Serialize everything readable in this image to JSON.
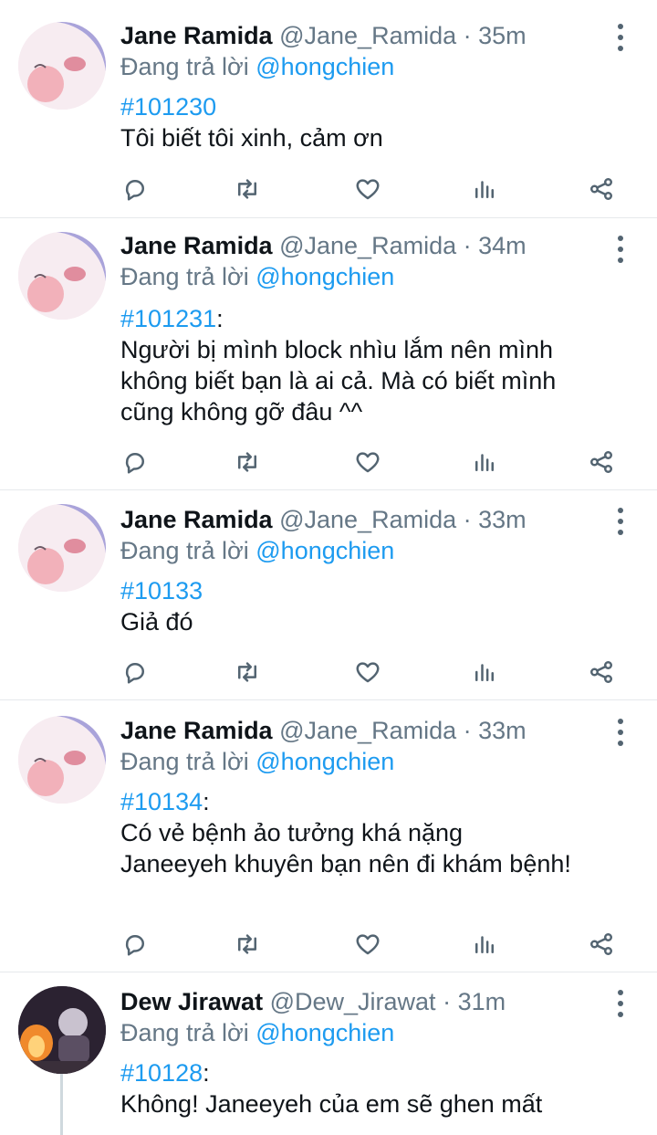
{
  "tweets": [
    {
      "name": "Jane Ramida",
      "handle": "@Jane_Ramida",
      "sep": "·",
      "time": "35m",
      "reply_prefix": "Đang trả lời ",
      "reply_to": "@hongchien",
      "hashtag": "#101230",
      "hash_suffix": "",
      "lines": [
        "Tôi biết tôi xinh, cảm ơn"
      ]
    },
    {
      "name": "Jane Ramida",
      "handle": "@Jane_Ramida",
      "sep": "·",
      "time": "34m",
      "reply_prefix": "Đang trả lời ",
      "reply_to": "@hongchien",
      "hashtag": "#101231",
      "hash_suffix": ":",
      "lines": [
        "Người bị mình block nhìu lắm nên mình",
        "không biết bạn là ai cả. Mà có biết mình",
        "cũng không gỡ đâu ^^"
      ]
    },
    {
      "name": "Jane Ramida",
      "handle": "@Jane_Ramida",
      "sep": "·",
      "time": "33m",
      "reply_prefix": "Đang trả lời ",
      "reply_to": "@hongchien",
      "hashtag": "#10133",
      "hash_suffix": "",
      "lines": [
        "Giả đó"
      ]
    },
    {
      "name": "Jane Ramida",
      "handle": "@Jane_Ramida",
      "sep": "·",
      "time": "33m",
      "reply_prefix": "Đang trả lời ",
      "reply_to": "@hongchien",
      "hashtag": "#10134",
      "hash_suffix": ":",
      "lines": [
        "Có vẻ bệnh ảo tưởng khá nặng",
        "Janeeyeh khuyên bạn nên đi khám bệnh!"
      ]
    },
    {
      "name": "Dew Jirawat",
      "handle": "@Dew_Jirawat",
      "sep": "·",
      "time": "31m",
      "reply_prefix": "Đang trả lời ",
      "reply_to": "@hongchien",
      "hashtag": "#10128",
      "hash_suffix": ":",
      "lines": [
        "Không! Janeeyeh của em sẽ ghen mất"
      ]
    }
  ],
  "icons": {
    "reply": "reply-icon",
    "retweet": "retweet-icon",
    "like": "heart-icon",
    "analytics": "analytics-icon",
    "share": "share-icon",
    "more": "more-vertical-icon"
  },
  "colors": {
    "link": "#1d9bf0",
    "muted": "#657786",
    "divider": "#e6e9ec"
  }
}
